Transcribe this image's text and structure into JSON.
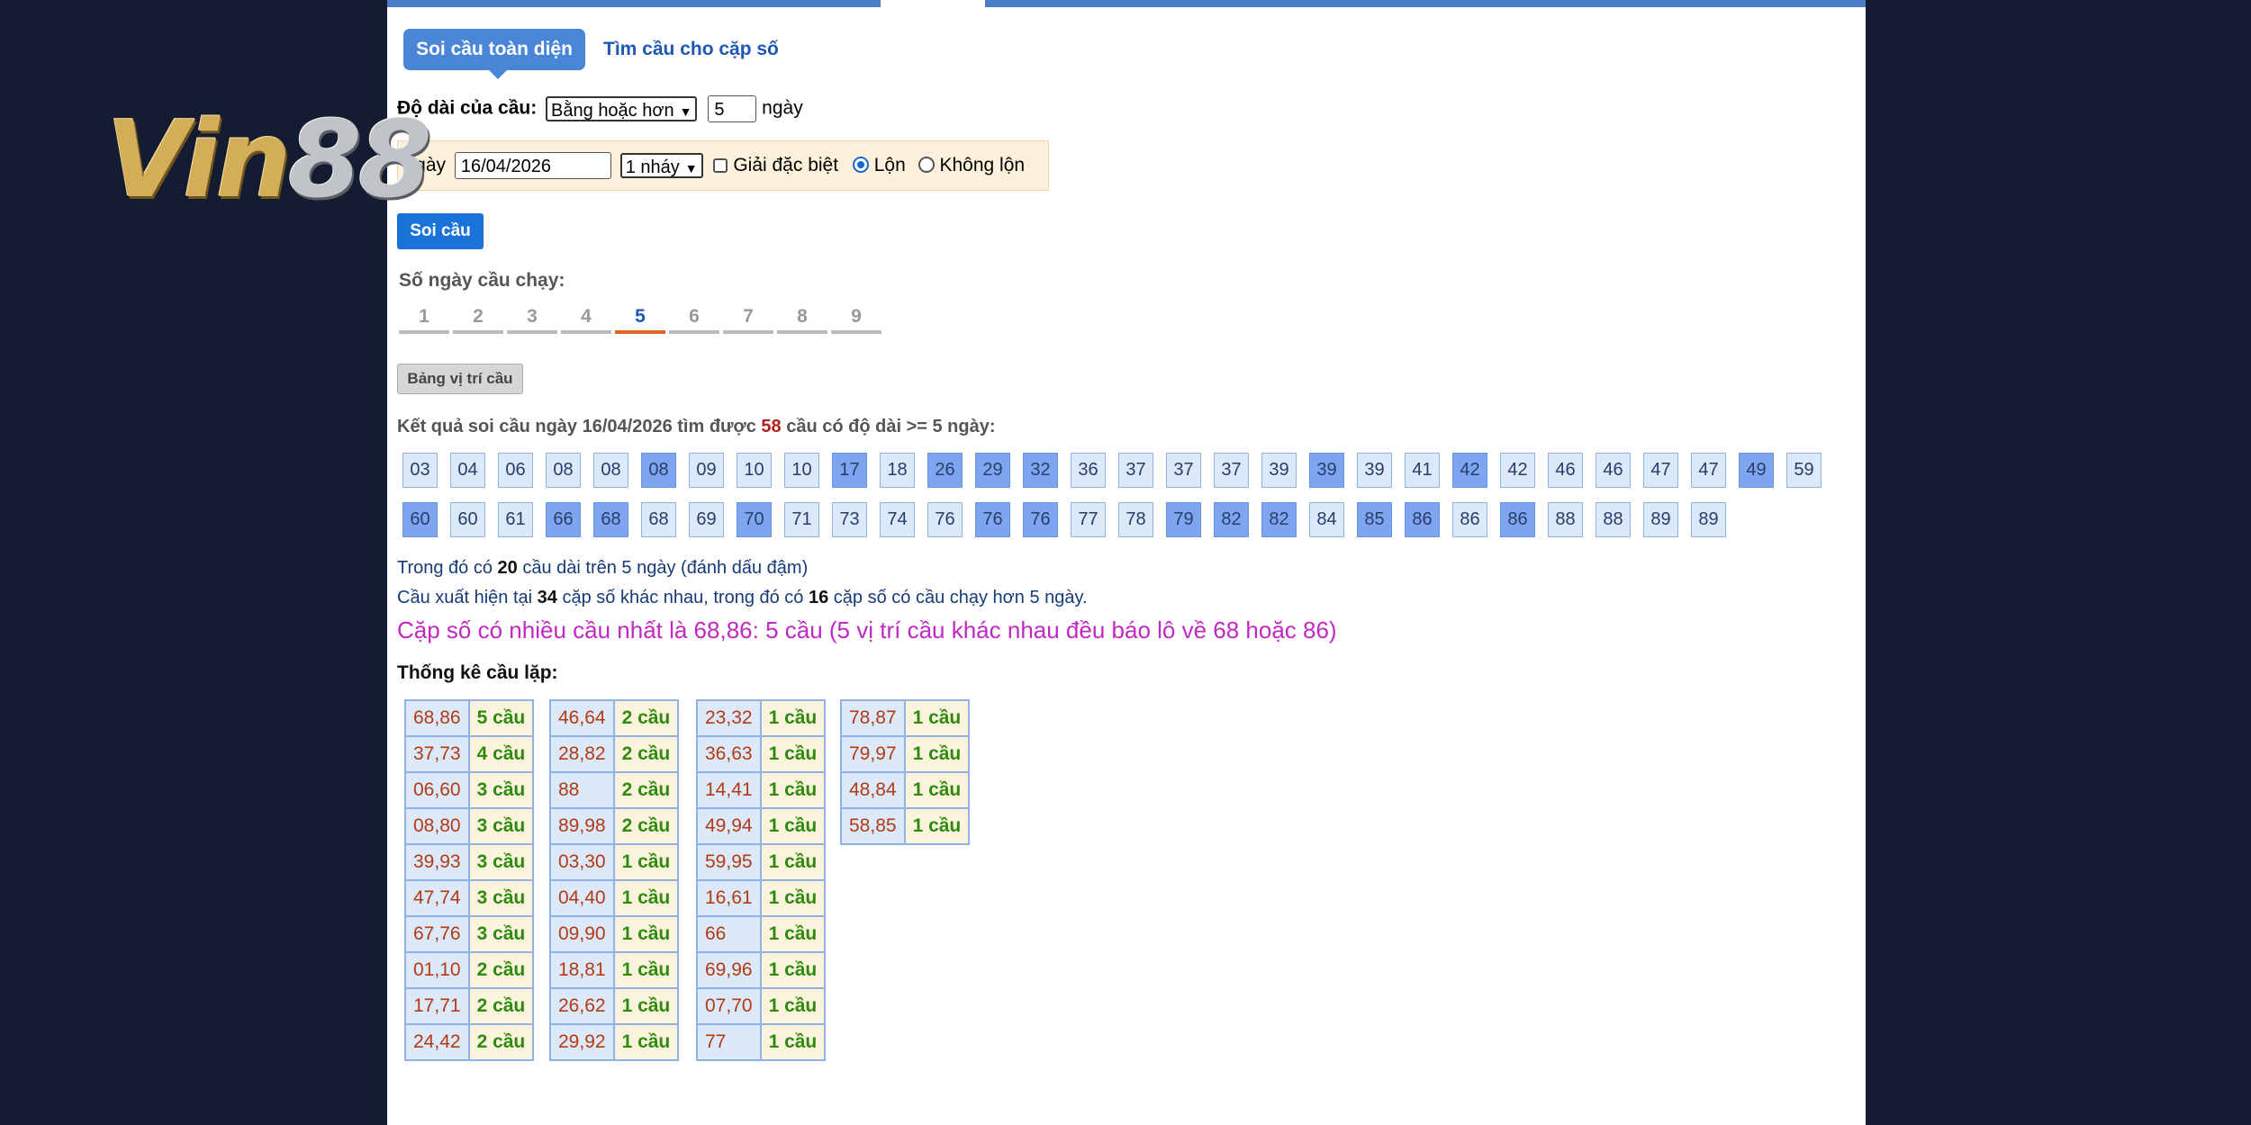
{
  "logo": {
    "text": "Vin88",
    "v_part": "Vin",
    "num_part": "88"
  },
  "tabs": {
    "active": "Soi cầu toàn diện",
    "other": "Tìm cầu cho cặp số"
  },
  "length_row": {
    "label": "Độ dài của cầu:",
    "select_value": "Bằng hoặc hơn",
    "input_value": "5",
    "unit": "ngày"
  },
  "date_row": {
    "label": "Ngày",
    "date_value": "16/04/2026",
    "nhay_value": "1 nháy",
    "checkbox_label": "Giải đặc biệt",
    "radio_lon": "Lộn",
    "radio_khong_lon": "Không lộn"
  },
  "soi_button": "Soi cầu",
  "days": {
    "label": "Số ngày cầu chạy:",
    "items": [
      "1",
      "2",
      "3",
      "4",
      "5",
      "6",
      "7",
      "8",
      "9"
    ],
    "active": "5"
  },
  "bang_button": "Bảng vị trí cầu",
  "result": {
    "prefix": "Kết quả soi cầu ngày 16/04/2026 tìm được ",
    "count": "58",
    "suffix": " cầu có độ dài >= 5 ngày:"
  },
  "numbers_row1": [
    {
      "v": "03",
      "b": false
    },
    {
      "v": "04",
      "b": false
    },
    {
      "v": "06",
      "b": false
    },
    {
      "v": "08",
      "b": false
    },
    {
      "v": "08",
      "b": false
    },
    {
      "v": "08",
      "b": true
    },
    {
      "v": "09",
      "b": false
    },
    {
      "v": "10",
      "b": false
    },
    {
      "v": "10",
      "b": false
    },
    {
      "v": "17",
      "b": true
    },
    {
      "v": "18",
      "b": false
    },
    {
      "v": "26",
      "b": true
    },
    {
      "v": "29",
      "b": true
    },
    {
      "v": "32",
      "b": true
    },
    {
      "v": "36",
      "b": false
    },
    {
      "v": "37",
      "b": false
    },
    {
      "v": "37",
      "b": false
    },
    {
      "v": "37",
      "b": false
    },
    {
      "v": "39",
      "b": false
    },
    {
      "v": "39",
      "b": true
    },
    {
      "v": "39",
      "b": false
    },
    {
      "v": "41",
      "b": false
    },
    {
      "v": "42",
      "b": true
    },
    {
      "v": "42",
      "b": false
    },
    {
      "v": "46",
      "b": false
    },
    {
      "v": "46",
      "b": false
    },
    {
      "v": "47",
      "b": false
    },
    {
      "v": "47",
      "b": false
    },
    {
      "v": "49",
      "b": true
    },
    {
      "v": "59",
      "b": false
    }
  ],
  "numbers_row2": [
    {
      "v": "60",
      "b": true
    },
    {
      "v": "60",
      "b": false
    },
    {
      "v": "61",
      "b": false
    },
    {
      "v": "66",
      "b": true
    },
    {
      "v": "68",
      "b": true
    },
    {
      "v": "68",
      "b": false
    },
    {
      "v": "69",
      "b": false
    },
    {
      "v": "70",
      "b": true
    },
    {
      "v": "71",
      "b": false
    },
    {
      "v": "73",
      "b": false
    },
    {
      "v": "74",
      "b": false
    },
    {
      "v": "76",
      "b": false
    },
    {
      "v": "76",
      "b": true
    },
    {
      "v": "76",
      "b": true
    },
    {
      "v": "77",
      "b": false
    },
    {
      "v": "78",
      "b": false
    },
    {
      "v": "79",
      "b": true
    },
    {
      "v": "82",
      "b": true
    },
    {
      "v": "82",
      "b": true
    },
    {
      "v": "84",
      "b": false
    },
    {
      "v": "85",
      "b": true
    },
    {
      "v": "86",
      "b": true
    },
    {
      "v": "86",
      "b": false
    },
    {
      "v": "86",
      "b": true
    },
    {
      "v": "88",
      "b": false
    },
    {
      "v": "88",
      "b": false
    },
    {
      "v": "89",
      "b": false
    },
    {
      "v": "89",
      "b": false
    }
  ],
  "info": {
    "line1_prefix": "Trong đó có ",
    "line1_count": "20",
    "line1_suffix": " cầu dài trên 5 ngày (đánh dấu đậm)",
    "line2_prefix": "Cầu xuất hiện tại ",
    "line2_pairs": "34",
    "line2_mid": " cặp số khác nhau, trong đó có ",
    "line2_count": "16",
    "line2_suffix": " cặp số có cầu chạy hơn 5 ngày.",
    "line3": "Cặp số có nhiều cầu nhất là 68,86: 5 cầu (5 vị trí cầu khác nhau đều báo lô về 68 hoặc 86)"
  },
  "stat_label": "Thống kê cầu lặp:",
  "stat_tables": [
    [
      [
        "68,86",
        "5 cầu"
      ],
      [
        "37,73",
        "4 cầu"
      ],
      [
        "06,60",
        "3 cầu"
      ],
      [
        "08,80",
        "3 cầu"
      ],
      [
        "39,93",
        "3 cầu"
      ],
      [
        "47,74",
        "3 cầu"
      ],
      [
        "67,76",
        "3 cầu"
      ],
      [
        "01,10",
        "2 cầu"
      ],
      [
        "17,71",
        "2 cầu"
      ],
      [
        "24,42",
        "2 cầu"
      ]
    ],
    [
      [
        "46,64",
        "2 cầu"
      ],
      [
        "28,82",
        "2 cầu"
      ],
      [
        "88",
        "2 cầu"
      ],
      [
        "89,98",
        "2 cầu"
      ],
      [
        "03,30",
        "1 cầu"
      ],
      [
        "04,40",
        "1 cầu"
      ],
      [
        "09,90",
        "1 cầu"
      ],
      [
        "18,81",
        "1 cầu"
      ],
      [
        "26,62",
        "1 cầu"
      ],
      [
        "29,92",
        "1 cầu"
      ]
    ],
    [
      [
        "23,32",
        "1 cầu"
      ],
      [
        "36,63",
        "1 cầu"
      ],
      [
        "14,41",
        "1 cầu"
      ],
      [
        "49,94",
        "1 cầu"
      ],
      [
        "59,95",
        "1 cầu"
      ],
      [
        "16,61",
        "1 cầu"
      ],
      [
        "66",
        "1 cầu"
      ],
      [
        "69,96",
        "1 cầu"
      ],
      [
        "07,70",
        "1 cầu"
      ],
      [
        "77",
        "1 cầu"
      ]
    ],
    [
      [
        "78,87",
        "1 cầu"
      ],
      [
        "79,97",
        "1 cầu"
      ],
      [
        "48,84",
        "1 cầu"
      ],
      [
        "58,85",
        "1 cầu"
      ]
    ]
  ]
}
